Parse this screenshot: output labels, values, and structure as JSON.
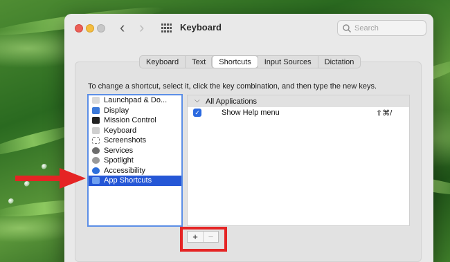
{
  "window": {
    "title": "Keyboard",
    "search_placeholder": "Search"
  },
  "tabs": [
    {
      "label": "Keyboard",
      "active": false
    },
    {
      "label": "Text",
      "active": false
    },
    {
      "label": "Shortcuts",
      "active": true
    },
    {
      "label": "Input Sources",
      "active": false
    },
    {
      "label": "Dictation",
      "active": false
    }
  ],
  "instructions": "To change a shortcut, select it, click the key combination, and then type the new keys.",
  "categories": [
    {
      "label": "Launchpad & Do...",
      "icon": "launchpad-icon",
      "color": "#d9d9d9",
      "selected": false
    },
    {
      "label": "Display",
      "icon": "display-icon",
      "color": "#3b78d8",
      "selected": false
    },
    {
      "label": "Mission Control",
      "icon": "mission-control-icon",
      "color": "#222222",
      "selected": false
    },
    {
      "label": "Keyboard",
      "icon": "keyboard-icon",
      "color": "#bdbdbd",
      "selected": false
    },
    {
      "label": "Screenshots",
      "icon": "screenshots-icon",
      "color": "#8a8a8a",
      "selected": false
    },
    {
      "label": "Services",
      "icon": "services-gear-icon",
      "color": "#6d6d6d",
      "selected": false
    },
    {
      "label": "Spotlight",
      "icon": "spotlight-icon",
      "color": "#8c8c8c",
      "selected": false
    },
    {
      "label": "Accessibility",
      "icon": "accessibility-icon",
      "color": "#2d6fdb",
      "selected": false
    },
    {
      "label": "App Shortcuts",
      "icon": "app-shortcuts-icon",
      "color": "#4a86e8",
      "selected": true
    }
  ],
  "shortcuts": {
    "group_label": "All Applications",
    "items": [
      {
        "enabled": true,
        "name": "Show Help menu",
        "keys": "⇧⌘/"
      }
    ]
  },
  "buttons": {
    "add": "+",
    "remove": "−"
  },
  "colors": {
    "selection": "#2557d6",
    "highlight_box": "#e52424",
    "arrow": "#e52424",
    "list_focus_ring": "#5b8ee6"
  }
}
